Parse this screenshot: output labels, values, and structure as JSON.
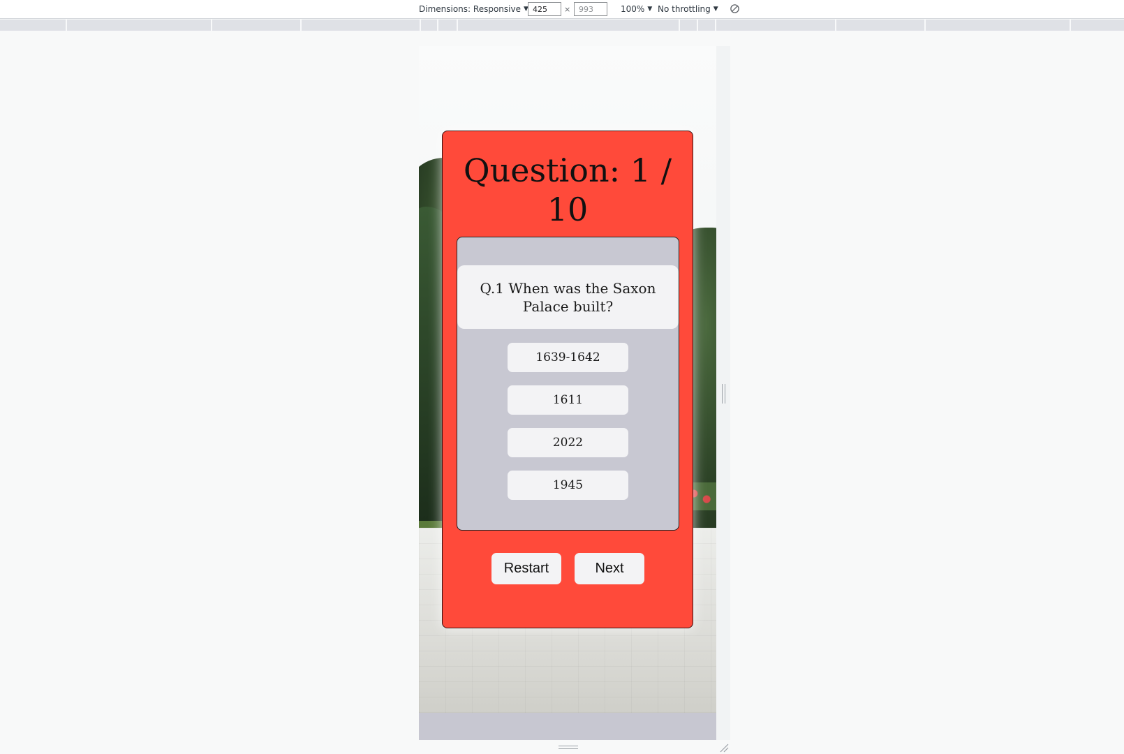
{
  "devtools": {
    "dimensions_label": "Dimensions: Responsive",
    "width_value": "425",
    "height_value": "993",
    "zoom_label": "100%",
    "throttling_label": "No throttling",
    "caret": "▼",
    "times": "×"
  },
  "quiz": {
    "counter": "Question: 1 / 10",
    "question": "Q.1 When was the Saxon Palace built?",
    "answers": [
      "1639-1642",
      "1611",
      "2022",
      "1945"
    ],
    "restart_label": "Restart",
    "next_label": "Next"
  },
  "colors": {
    "card": "#ff4a3a",
    "panel": "#c8c8d2",
    "button": "#f3f3f5"
  }
}
